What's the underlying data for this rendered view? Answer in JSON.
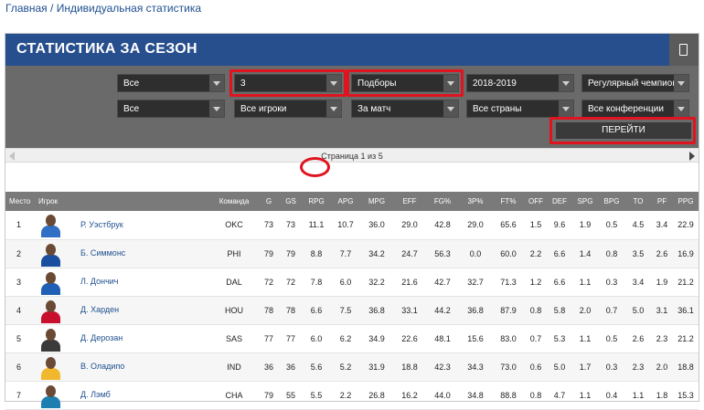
{
  "breadcrumb": {
    "home": "Главная",
    "sep": " / ",
    "current": "Индивидуальная статистика"
  },
  "header": {
    "title": "СТАТИСТИКА ЗА СЕЗОН"
  },
  "filters": {
    "row1": [
      "Все",
      "3",
      "Подборы",
      "2018-2019",
      "Регулярный чемпионат"
    ],
    "row2": [
      "Все",
      "Все игроки",
      "За матч",
      "Все страны",
      "Все конференции"
    ],
    "go": "ПЕРЕЙТИ"
  },
  "pager": {
    "text": "Страница 1 из 5"
  },
  "table": {
    "headers": [
      "Место",
      "Игрок",
      "Команда",
      "G",
      "GS",
      "RPG",
      "APG",
      "MPG",
      "EFF",
      "FG%",
      "3P%",
      "FT%",
      "OFF",
      "DEF",
      "SPG",
      "BPG",
      "TO",
      "PF",
      "PPG"
    ],
    "rows": [
      [
        "1",
        "Р. Уэстбрук",
        "OKC",
        "73",
        "73",
        "11.1",
        "10.7",
        "36.0",
        "29.0",
        "42.8",
        "29.0",
        "65.6",
        "1.5",
        "9.6",
        "1.9",
        "0.5",
        "4.5",
        "3.4",
        "22.9"
      ],
      [
        "2",
        "Б. Симмонс",
        "PHI",
        "79",
        "79",
        "8.8",
        "7.7",
        "34.2",
        "24.7",
        "56.3",
        "0.0",
        "60.0",
        "2.2",
        "6.6",
        "1.4",
        "0.8",
        "3.5",
        "2.6",
        "16.9"
      ],
      [
        "3",
        "Л. Дончич",
        "DAL",
        "72",
        "72",
        "7.8",
        "6.0",
        "32.2",
        "21.6",
        "42.7",
        "32.7",
        "71.3",
        "1.2",
        "6.6",
        "1.1",
        "0.3",
        "3.4",
        "1.9",
        "21.2"
      ],
      [
        "4",
        "Д. Харден",
        "HOU",
        "78",
        "78",
        "6.6",
        "7.5",
        "36.8",
        "33.1",
        "44.2",
        "36.8",
        "87.9",
        "0.8",
        "5.8",
        "2.0",
        "0.7",
        "5.0",
        "3.1",
        "36.1"
      ],
      [
        "5",
        "Д. Дерозан",
        "SAS",
        "77",
        "77",
        "6.0",
        "6.2",
        "34.9",
        "22.6",
        "48.1",
        "15.6",
        "83.0",
        "0.7",
        "5.3",
        "1.1",
        "0.5",
        "2.6",
        "2.3",
        "21.2"
      ],
      [
        "6",
        "В. Оладипо",
        "IND",
        "36",
        "36",
        "5.6",
        "5.2",
        "31.9",
        "18.8",
        "42.3",
        "34.3",
        "73.0",
        "0.6",
        "5.0",
        "1.7",
        "0.3",
        "2.3",
        "2.0",
        "18.8"
      ],
      [
        "7",
        "Д. Лэмб",
        "CHA",
        "79",
        "55",
        "5.5",
        "2.2",
        "26.8",
        "16.2",
        "44.0",
        "34.8",
        "88.8",
        "0.8",
        "4.7",
        "1.1",
        "0.4",
        "1.1",
        "1.8",
        "15.3"
      ]
    ],
    "jersey_colors": [
      "#2f6fc4",
      "#1a4fa0",
      "#1f5fb5",
      "#c8102e",
      "#3a3a3a",
      "#f2b82d",
      "#1d7fb0"
    ]
  },
  "colors": {
    "header_bg": "#274f8e",
    "highlight": "#e0141f",
    "link": "#1e4f8f"
  }
}
